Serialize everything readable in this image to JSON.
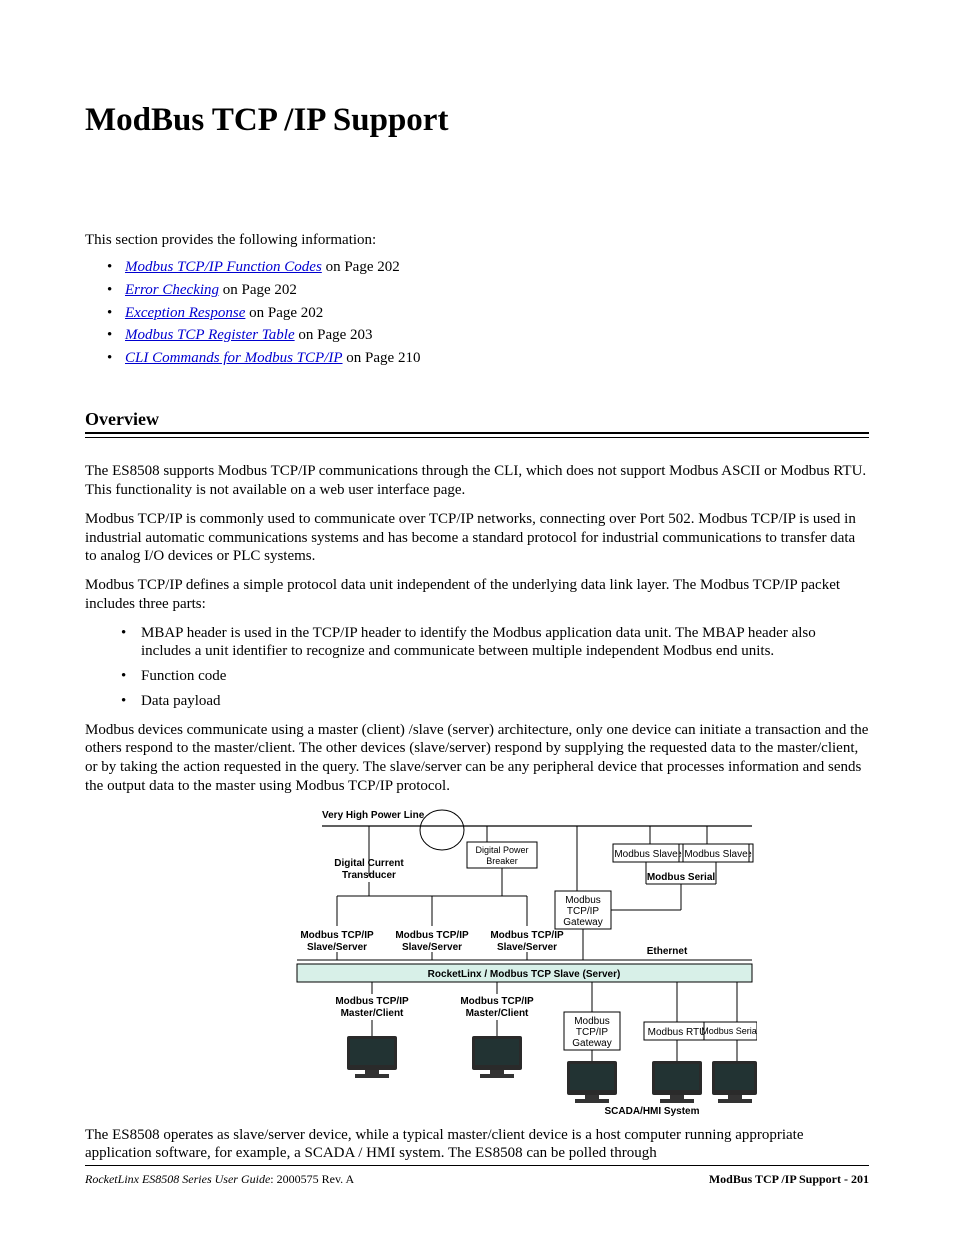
{
  "title": "ModBus TCP /IP Support",
  "intro": "This section provides the following information:",
  "toc": [
    {
      "label": "Modbus TCP/IP Function Codes",
      "suffix": " on Page 202"
    },
    {
      "label": "Error Checking",
      "suffix": " on Page 202"
    },
    {
      "label": "Exception Response",
      "suffix": " on Page 202"
    },
    {
      "label": "Modbus TCP Register Table",
      "suffix": " on Page 203"
    },
    {
      "label": "CLI Commands for Modbus TCP/IP",
      "suffix": " on Page 210"
    }
  ],
  "overview_heading": "Overview",
  "overview": {
    "p1": "The ES8508 supports Modbus TCP/IP communications through the CLI, which does not support Modbus ASCII or Modbus RTU. This functionality is not available on a web user interface page.",
    "p2": "Modbus TCP/IP is commonly used to communicate over TCP/IP networks, connecting over Port 502. Modbus TCP/IP is used in industrial automatic communications systems and has become a standard protocol for industrial communications to transfer data to analog I/O devices or PLC systems.",
    "p3": "Modbus TCP/IP defines a simple protocol data unit independent of the underlying data link layer. The Modbus TCP/IP packet includes three parts:",
    "bullets": [
      "MBAP header is used in the TCP/IP header to identify the Modbus application data unit. The MBAP header also includes a unit identifier to recognize and communicate between multiple independent Modbus end units.",
      "Function code",
      "Data payload"
    ],
    "p4": "Modbus devices communicate using a master (client) /slave (server) architecture, only one device can initiate a transaction and the others respond to the master/client. The other devices (slave/server) respond by supplying the requested data to the master/client, or by taking the action requested in the query. The slave/server can be any peripheral device that processes information and sends the output data to the master using Modbus TCP/IP protocol.",
    "p5": "The ES8508 operates as slave/server device, while a typical master/client device is a host computer running appropriate application software, for example, a SCADA / HMI system. The ES8508 can be polled through"
  },
  "diagram": {
    "very_high_power_line": "Very High Power Line",
    "digital_current_transducer": "Digital Current\nTransducer",
    "digital_power_breaker": "Digital Power\nBreaker",
    "modbus_slave": "Modbus Slave",
    "modbus_serial": "Modbus Serial",
    "modbus_tcpip_gateway_l1": "Modbus",
    "modbus_tcpip_gateway_l2": "TCP/IP",
    "modbus_tcpip_gateway_l3": "Gateway",
    "modbus_tcpip_slave_server_l1": "Modbus TCP/IP",
    "modbus_tcpip_slave_server_l2": "Slave/Server",
    "ethernet": "Ethernet",
    "rocketlinx_bar": "RocketLinx / Modbus TCP Slave (Server)",
    "modbus_tcpip_master_client_l1": "Modbus TCP/IP",
    "modbus_tcpip_master_client_l2": "Master/Client",
    "modbus_rtu": "Modbus RTU",
    "scada_hmi": "SCADA/HMI System"
  },
  "footer": {
    "left_italic": "RocketLinx ES8508 Series  User Guide",
    "left_rev": ": 2000575 Rev. A",
    "right": "ModBus TCP /IP Support - 201"
  }
}
